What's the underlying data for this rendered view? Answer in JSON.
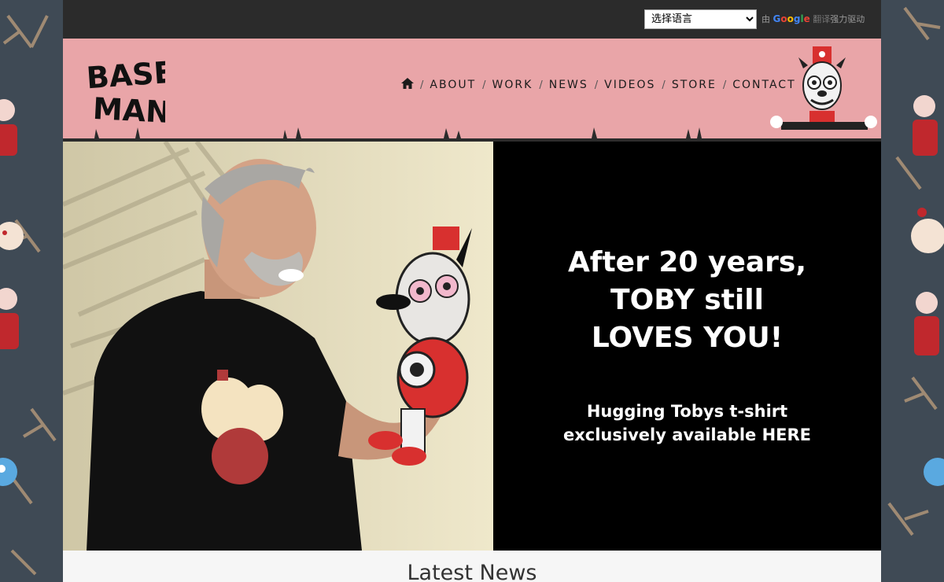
{
  "language_widget": {
    "select_value": "选择语言",
    "powered_by_prefix": "由",
    "google_letters": [
      "G",
      "o",
      "o",
      "g",
      "l",
      "e"
    ],
    "translate_text": "翻译",
    "powered_by_suffix": "强力驱动"
  },
  "header": {
    "logo_lines": [
      "BASE",
      "MAN"
    ],
    "nav": [
      {
        "label": "ABOUT"
      },
      {
        "label": "WORK"
      },
      {
        "label": "NEWS"
      },
      {
        "label": "VIDEOS"
      },
      {
        "label": "STORE"
      },
      {
        "label": "CONTACT"
      }
    ],
    "nav_separator": "/"
  },
  "hero": {
    "headline_lines": [
      "After 20 years,",
      "TOBY still",
      "LOVES YOU!"
    ],
    "sub_lines": [
      "Hugging Tobys t-shirt",
      "exclusively available HERE"
    ]
  },
  "news": {
    "title": "Latest News"
  },
  "colors": {
    "header_bg": "#e9a5a8",
    "topbar_bg": "#2b2b2b",
    "hero_bg": "#000000",
    "news_bg": "#f6f6f6"
  }
}
